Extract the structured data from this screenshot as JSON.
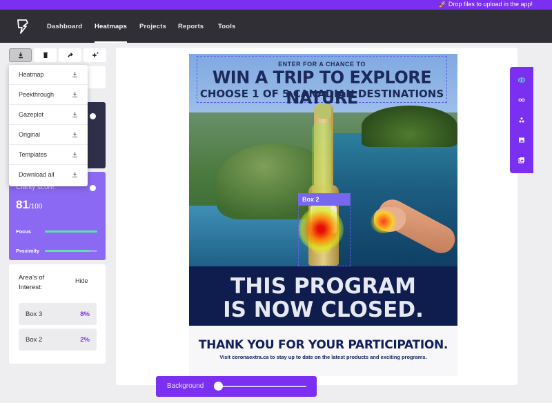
{
  "banner": {
    "text": "🚀 Drop files to upload in the app!"
  },
  "nav": {
    "items": [
      "Dashboard",
      "Heatmaps",
      "Projects",
      "Reports",
      "Tools"
    ],
    "active": "Heatmaps"
  },
  "toolbar": {
    "buttons": [
      "download-icon",
      "trash-icon",
      "share-icon",
      "sparkle-icon"
    ]
  },
  "download_menu": {
    "items": [
      "Heatmap",
      "Peekthrough",
      "Gazeplot",
      "Original",
      "Templates",
      "Download all"
    ]
  },
  "clarity": {
    "label": "Clarity score:",
    "score": "81",
    "max": "/100",
    "bars": [
      {
        "label": "Focus",
        "fill": 1.0
      },
      {
        "label": "Proximity",
        "fill": 0.85
      }
    ]
  },
  "aoi": {
    "title": "Area's of Interest:",
    "hide_label": "Hide",
    "rows": [
      {
        "name": "Box 3",
        "pct": "8%"
      },
      {
        "name": "Box 2",
        "pct": "2%"
      }
    ]
  },
  "ad": {
    "line1": "ENTER FOR A CHANCE TO",
    "line2": "WIN A TRIP TO EXPLORE NATURE",
    "line3": "CHOOSE 1 OF 5 CANADIAN DESTINATIONS",
    "box_tag": "Box 2",
    "closed_line1": "THIS PROGRAM",
    "closed_line2": "IS NOW CLOSED.",
    "thanks": "THANK YOU FOR YOUR PARTICIPATION.",
    "visit": "Visit coronaextra.ca to stay up to date on the latest products and exciting programs."
  },
  "right_toolbar": {
    "icons": [
      "eye-icon",
      "glasses-icon",
      "gazeplot-icon",
      "image-icon",
      "gallery-icon"
    ]
  },
  "background_control": {
    "label": "Background",
    "value": 0.0
  },
  "colors": {
    "accent": "#7b2ff0",
    "nav_bg": "#2f2f35",
    "score_card": "#8b69f2"
  }
}
